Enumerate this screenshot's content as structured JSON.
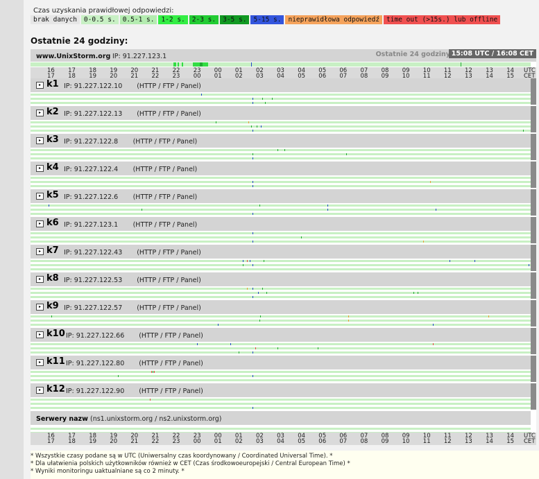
{
  "legend": {
    "title": "Czas uzyskania prawidłowej odpowiedzi:",
    "items": [
      {
        "label": "brak danych",
        "color": "#e6e6e6"
      },
      {
        "label": "0-0.5 s.",
        "color": "#c8f0c4"
      },
      {
        "label": "0.5-1 s.",
        "color": "#b4ecb0"
      },
      {
        "label": "1-2 s.",
        "color": "#33ee44"
      },
      {
        "label": "2-3 s.",
        "color": "#22cc33"
      },
      {
        "label": "3-5 s.",
        "color": "#119922"
      },
      {
        "label": "5-15 s.",
        "color": "#3355dd"
      },
      {
        "label": "nieprawidłowa odpowiedź",
        "color": "#f5a35c"
      },
      {
        "label": "time out (>15s.) lub offline",
        "color": "#f05050"
      }
    ]
  },
  "heading": "Ostatnie 24 godziny:",
  "site": {
    "name": "www.UnixStorm.org",
    "ip": "IP: 91.227.123.1",
    "period": "Ostatnie 24 godziny",
    "time": "15:08 UTC / 16:08 CET"
  },
  "timeline": {
    "utc": [
      "16",
      "17",
      "18",
      "19",
      "20",
      "21",
      "22",
      "23",
      "00",
      "01",
      "02",
      "03",
      "04",
      "05",
      "06",
      "07",
      "08",
      "09",
      "10",
      "11",
      "12",
      "13",
      "14"
    ],
    "cet": [
      "17",
      "18",
      "19",
      "20",
      "21",
      "22",
      "23",
      "00",
      "01",
      "02",
      "03",
      "04",
      "05",
      "06",
      "07",
      "08",
      "09",
      "10",
      "11",
      "12",
      "13",
      "14",
      "15"
    ],
    "end_top": "UTC",
    "end_bottom": "CET"
  },
  "colors": {
    "green": "#22aa33",
    "light": "#55dd55",
    "blue": "#2244cc",
    "orange": "#ee9933",
    "red": "#ee4444"
  },
  "servers": [
    {
      "name": "k1",
      "ip": "IP: 91.227.122.10",
      "services": "(HTTP / FTP / Panel)"
    },
    {
      "name": "k2",
      "ip": "IP: 91.227.122.13",
      "services": "(HTTP / FTP / Panel)"
    },
    {
      "name": "k3",
      "ip": "IP: 91.227.122.8",
      "services": "(HTTP / FTP / Panel)"
    },
    {
      "name": "k4",
      "ip": "IP: 91.227.122.4",
      "services": "(HTTP / FTP / Panel)"
    },
    {
      "name": "k5",
      "ip": "IP: 91.227.122.6",
      "services": "(HTTP / FTP / Panel)"
    },
    {
      "name": "k6",
      "ip": "IP: 91.227.123.1",
      "services": "(HTTP / FTP / Panel)"
    },
    {
      "name": "k7",
      "ip": "IP: 91.227.122.43",
      "services": "(HTTP / FTP / Panel)"
    },
    {
      "name": "k8",
      "ip": "IP: 91.227.122.53",
      "services": "(HTTP / FTP / Panel)"
    },
    {
      "name": "k9",
      "ip": "IP: 91.227.122.57",
      "services": "(HTTP / FTP / Panel)"
    },
    {
      "name": "k10",
      "ip": "IP: 91.227.122.66",
      "services": "(HTTP / FTP / Panel)"
    },
    {
      "name": "k11",
      "ip": "IP: 91.227.122.80",
      "services": "(HTTP / FTP / Panel)"
    },
    {
      "name": "k12",
      "ip": "IP: 91.227.122.90",
      "services": "(HTTP / FTP / Panel)"
    }
  ],
  "nameservers": {
    "name": "Serwery nazw",
    "detail": "(ns1.unixstorm.org / ns2.unixstorm.org)"
  },
  "notes": [
    "* Wszystkie czasy podane są w UTC (Uniwersalny czas koordynowany / Coordinated Universal Time). *",
    "* Dla ułatwienia polskich użytkowników również w CET (Czas środkowoeuropejski / Central European Time) *",
    "* Wyniki monitoringu uaktualniane są co 2 minuty. *"
  ]
}
